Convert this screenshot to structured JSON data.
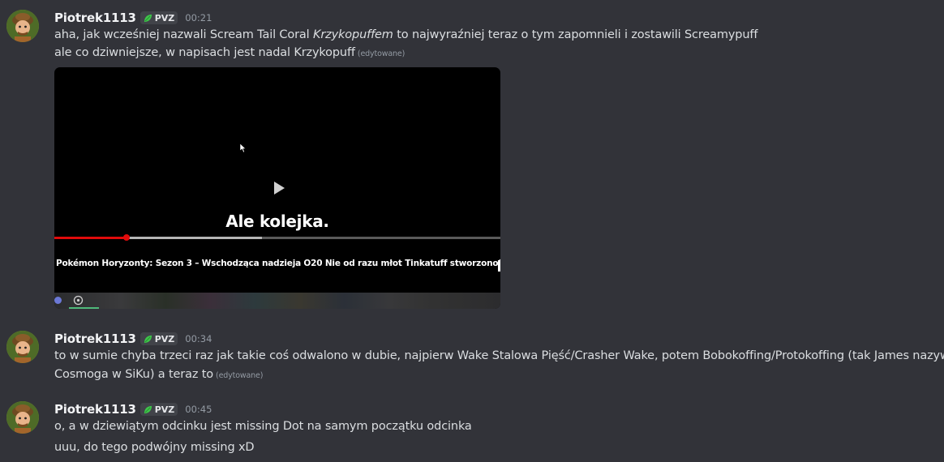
{
  "messages": [
    {
      "username": "Piotrek1113",
      "tag": "PVZ",
      "time": "00:21",
      "lines": [
        {
          "before": "aha, jak wcześniej nazwali Scream Tail Coral ",
          "italic": "Krzykopuffem",
          "after": " to najwyraźniej teraz o tym zapomnieli i zostawili Screamypuff"
        },
        {
          "text": "ale co dziwniejsze, w napisach jest nadal Krzykopuff",
          "edited": "(edytowane)"
        }
      ],
      "video": {
        "subtitle": "Ale kolejka.",
        "title": "Pokémon Horyzonty: Sezon 3 – Wschodząca nadzieja O20  Nie od razu młot Tinkatuff stworzono!",
        "progress_played": 0.162,
        "progress_buffered": 0.466
      }
    },
    {
      "username": "Piotrek1113",
      "tag": "PVZ",
      "time": "00:34",
      "lines": [
        {
          "text": "to w sumie chyba trzeci raz jak takie coś odwalono w dubie, najpierw Wake Stalowa Pięść/Crasher Wake, potem Bobokoffing/Protokoffing (tak James nazywał"
        },
        {
          "text": "Cosmoga w SiKu) a teraz to",
          "edited": "(edytowane)"
        }
      ]
    },
    {
      "username": "Piotrek1113",
      "tag": "PVZ",
      "time": "00:45",
      "lines": [
        {
          "text": "o, a w dziewiątym odcinku jest missing Dot na samym początku odcinka"
        },
        {
          "text": "uuu, do tego podwójny missing xD"
        }
      ]
    }
  ],
  "colors": {
    "background": "#323339",
    "tag_leaf": "#3ec74a",
    "progress": "#e00b0b"
  },
  "icons": [
    "avatar",
    "leaf-icon",
    "cursor-icon",
    "play-icon",
    "settings-icon"
  ]
}
